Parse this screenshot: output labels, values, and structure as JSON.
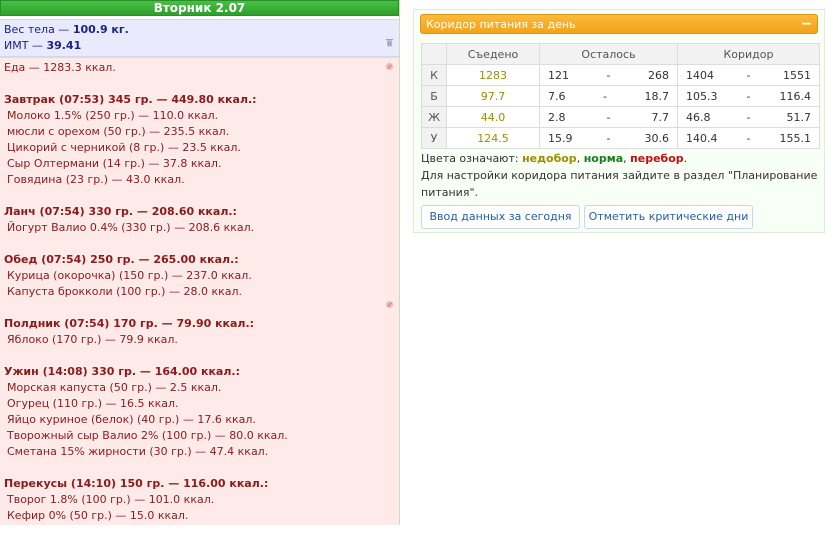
{
  "day": {
    "title": "Вторник 2.07"
  },
  "weight": {
    "label": "Вес тела — ",
    "value": "100.9 кг.",
    "bmi_label": "ИМТ — ",
    "bmi_value": "39.41"
  },
  "food": {
    "total": "Еда — 1283.3 ккал.",
    "meals": [
      {
        "title": "Завтрак (07:53) 345 гр. — 449.80 ккал.:",
        "items": [
          "Молоко 1.5% (250 гр.) — 110.0 ккал.",
          "мюсли с орехом (50 гр.) — 235.5 ккал.",
          "Цикорий с черникой (8 гр.) — 23.5 ккал.",
          "Сыр Олтермани (14 гр.) — 37.8 ккал.",
          "Говядина (23 гр.) — 43.0 ккал."
        ]
      },
      {
        "title": "Ланч (07:54) 330 гр. — 208.60 ккал.:",
        "items": [
          "Йогурт Валио 0.4% (330 гр.) — 208.6 ккал."
        ]
      },
      {
        "title": "Обед (07:54) 250 гр. — 265.00 ккал.:",
        "items": [
          "Курица (окорочка) (150 гр.) — 237.0 ккал.",
          "Капуста брокколи (100 гр.) — 28.0 ккал."
        ]
      },
      {
        "title": "Полдник (07:54) 170 гр. — 79.90 ккал.:",
        "items": [
          "Яблоко (170 гр.) — 79.9 ккал."
        ]
      },
      {
        "title": "Ужин (14:08) 330 гр. — 164.00 ккал.:",
        "items": [
          "Морская капуста (50 гр.) — 2.5 ккал.",
          "Огурец (110 гр.) — 16.5 ккал.",
          "Яйцо куриное (белок) (40 гр.) — 17.6 ккал.",
          "Творожный сыр Валио 2% (100 гр.) — 80.0 ккал.",
          "Сметана 15% жирности (30 гр.) — 47.4 ккал."
        ]
      },
      {
        "title": "Перекусы (14:10) 150 гр. — 116.00 ккал.:",
        "items": [
          "Творог 1.8% (100 гр.) — 101.0 ккал.",
          "Кефир 0% (50 гр.) — 15.0 ккал."
        ]
      }
    ]
  },
  "corridor": {
    "title": "Коридор питания за день",
    "collapse_label": "−",
    "headers": {
      "eaten": "Съедено",
      "left": "Осталось",
      "corridor": "Коридор"
    },
    "dash": "-",
    "rows": [
      {
        "label": "К",
        "eaten": "1283",
        "left_min": "121",
        "left_max": "268",
        "cor_min": "1404",
        "cor_max": "1551"
      },
      {
        "label": "Б",
        "eaten": "97.7",
        "left_min": "7.6",
        "left_max": "18.7",
        "cor_min": "105.3",
        "cor_max": "116.4"
      },
      {
        "label": "Ж",
        "eaten": "44.0",
        "left_min": "2.8",
        "left_max": "7.7",
        "cor_min": "46.8",
        "cor_max": "51.7"
      },
      {
        "label": "У",
        "eaten": "124.5",
        "left_min": "15.9",
        "left_max": "30.6",
        "cor_min": "140.4",
        "cor_max": "155.1"
      }
    ],
    "legend": {
      "prefix": "Цвета означают: ",
      "under": "недобор",
      "sep1": ", ",
      "norm": "норма",
      "sep2": ", ",
      "over": "перебор",
      "end": "."
    },
    "note": "Для настройки коридора питания зайдите в раздел \"Планирование питания\".",
    "buttons": {
      "enter_today": "Ввод данных за сегодня",
      "critical_days": "Отметить критические дни"
    }
  },
  "colors": {
    "header_green": "#3cb43a",
    "widget_orange": "#f6a823",
    "food_bg": "#ffeaea",
    "weight_bg": "#eaeaff"
  },
  "icons": [
    "trash-icon",
    "edit-icon",
    "collapse-icon"
  ]
}
